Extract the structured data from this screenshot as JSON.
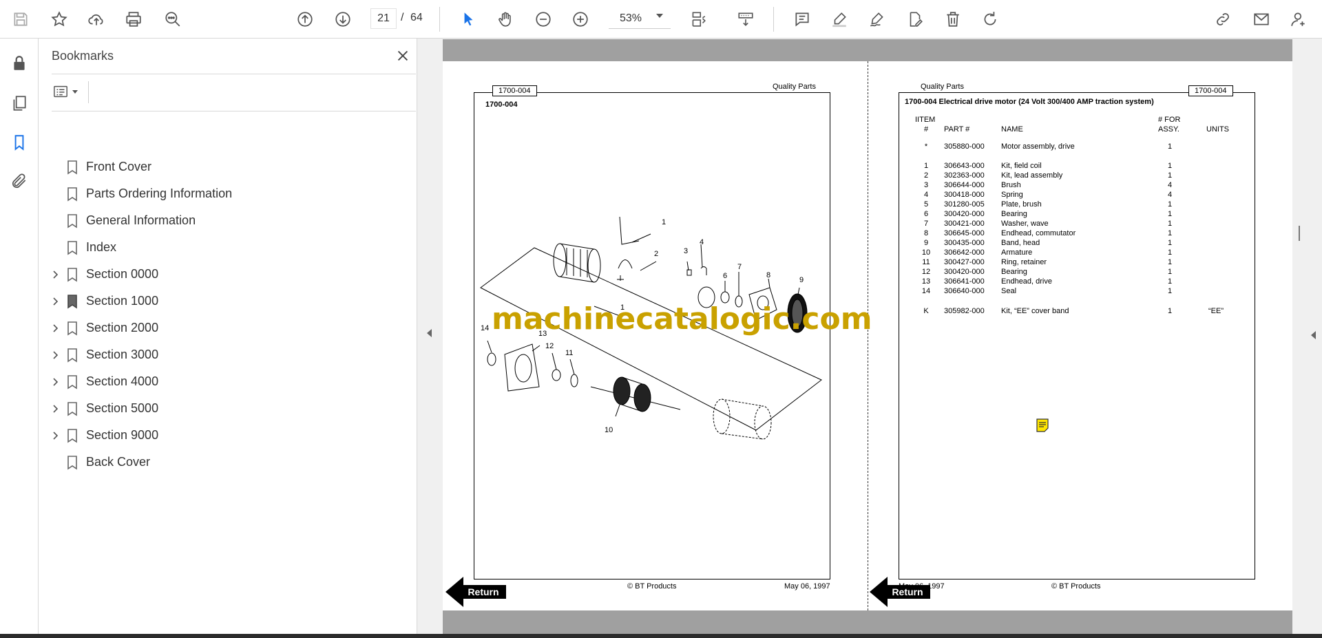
{
  "toolbar": {
    "page_current": "21",
    "page_separator": "/",
    "page_total": "64",
    "zoom": "53%"
  },
  "bookmarks": {
    "title": "Bookmarks",
    "items": [
      {
        "label": "Front Cover",
        "expandable": false
      },
      {
        "label": "Parts Ordering Information",
        "expandable": false
      },
      {
        "label": "General Information",
        "expandable": false
      },
      {
        "label": "Index",
        "expandable": false
      },
      {
        "label": "Section 0000",
        "expandable": true
      },
      {
        "label": "Section 1000",
        "expandable": true
      },
      {
        "label": "Section 2000",
        "expandable": true
      },
      {
        "label": "Section 3000",
        "expandable": true
      },
      {
        "label": "Section 4000",
        "expandable": true
      },
      {
        "label": "Section 5000",
        "expandable": true
      },
      {
        "label": "Section 9000",
        "expandable": true
      },
      {
        "label": "Back Cover",
        "expandable": false
      }
    ]
  },
  "left_page": {
    "tag": "1700-004",
    "header_right": "Quality Parts",
    "subtitle": "1700-004",
    "footer_center": "© BT Products",
    "footer_right": "May 06, 1997",
    "callouts": [
      "1",
      "2",
      "3",
      "4",
      "6",
      "7",
      "8",
      "9",
      "1",
      "14",
      "13",
      "12",
      "11",
      "10"
    ]
  },
  "right_page": {
    "header_left": "Quality Parts",
    "tag": "1700-004",
    "title": "1700-004 Electrical drive motor (24 Volt 300/400 AMP traction system)",
    "col_item_top": "IITEM",
    "col_item": "#",
    "col_part": "PART #",
    "col_name": "NAME",
    "col_for_top": "# FOR",
    "col_for": "ASSY.",
    "col_units": "UNITS",
    "rows": [
      {
        "item": "*",
        "part": "305880-000",
        "name": "Motor assembly, drive",
        "qty": "1",
        "units": ""
      },
      {
        "item": "1",
        "part": "306643-000",
        "name": "Kit, field coil",
        "qty": "1",
        "units": ""
      },
      {
        "item": "2",
        "part": "302363-000",
        "name": "Kit, lead assembly",
        "qty": "1",
        "units": ""
      },
      {
        "item": "3",
        "part": "306644-000",
        "name": "Brush",
        "qty": "4",
        "units": ""
      },
      {
        "item": "4",
        "part": "300418-000",
        "name": "Spring",
        "qty": "4",
        "units": ""
      },
      {
        "item": "5",
        "part": "301280-005",
        "name": "Plate, brush",
        "qty": "1",
        "units": ""
      },
      {
        "item": "6",
        "part": "300420-000",
        "name": "Bearing",
        "qty": "1",
        "units": ""
      },
      {
        "item": "7",
        "part": "300421-000",
        "name": "Washer, wave",
        "qty": "1",
        "units": ""
      },
      {
        "item": "8",
        "part": "306645-000",
        "name": "Endhead, commutator",
        "qty": "1",
        "units": ""
      },
      {
        "item": "9",
        "part": "300435-000",
        "name": "Band, head",
        "qty": "1",
        "units": ""
      },
      {
        "item": "10",
        "part": "306642-000",
        "name": "Armature",
        "qty": "1",
        "units": ""
      },
      {
        "item": "11",
        "part": "300427-000",
        "name": "Ring, retainer",
        "qty": "1",
        "units": ""
      },
      {
        "item": "12",
        "part": "300420-000",
        "name": "Bearing",
        "qty": "1",
        "units": ""
      },
      {
        "item": "13",
        "part": "306641-000",
        "name": "Endhead, drive",
        "qty": "1",
        "units": ""
      },
      {
        "item": "14",
        "part": "306640-000",
        "name": "Seal",
        "qty": "1",
        "units": ""
      },
      {
        "item": "K",
        "part": "305982-000",
        "name": "Kit, “EE” cover band",
        "qty": "1",
        "units": "“EE”"
      }
    ],
    "footer_left": "May 06, 1997",
    "footer_center": "© BT Products"
  },
  "watermark": "machinecatalogic.com",
  "return_label": "Return"
}
